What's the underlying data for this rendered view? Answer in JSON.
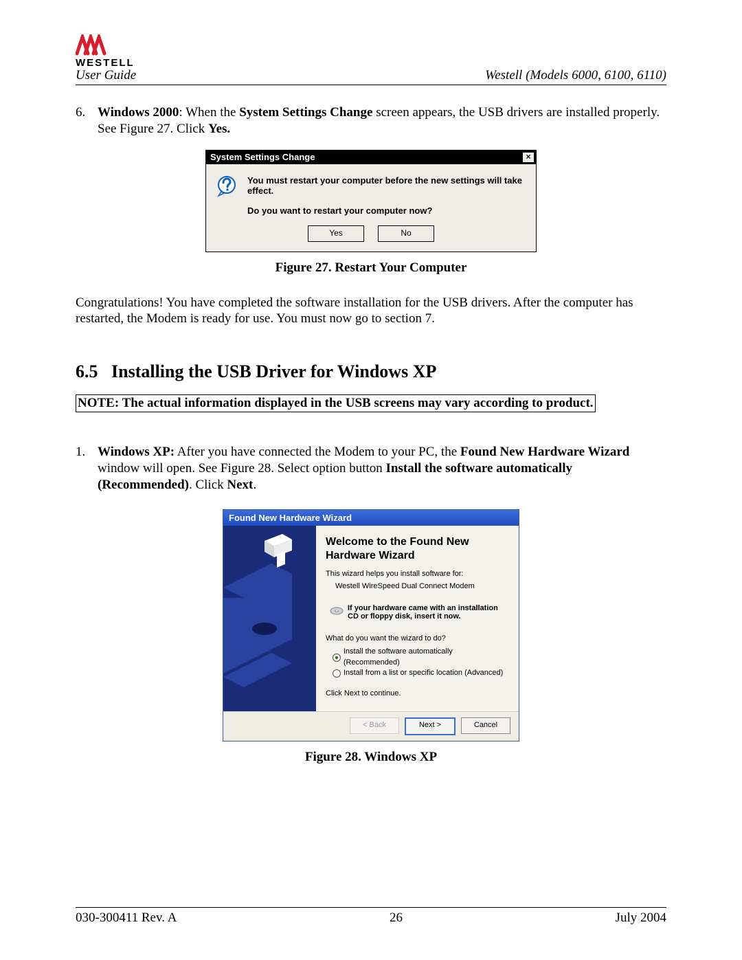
{
  "header": {
    "logo_text": "WESTELL",
    "user_guide": "User Guide",
    "models": "Westell (Models 6000, 6100, 6110)"
  },
  "step6": {
    "num": "6.",
    "bold1": "Windows 2000",
    "text1": ": When the ",
    "bold2": "System Settings Change",
    "text2": " screen appears, the USB drivers are installed properly. See Figure 27. Click ",
    "bold3": "Yes."
  },
  "dlg27": {
    "title": "System Settings Change",
    "close": "×",
    "msg1": "You must restart your computer before the new settings will take effect.",
    "msg2": "Do you want to restart your computer now?",
    "yes": "Yes",
    "no": "No",
    "caption": "Figure 27. Restart Your Computer"
  },
  "congrats": "Congratulations! You have completed the software installation for the USB drivers. After the computer has restarted, the Modem is ready for use. You must now go to section 7.",
  "section": {
    "num": "6.5",
    "title": "Installing the USB Driver for Windows XP"
  },
  "note": "NOTE: The actual information displayed in the USB screens may vary according to product.",
  "step1": {
    "num": "1.",
    "bold1": "Windows XP:",
    "text1": " After you have connected the Modem to your PC, the ",
    "bold2": "Found New Hardware Wizard",
    "text2": " window will open. See Figure 28. Select option button ",
    "bold3": "Install the software automatically (Recommended)",
    "text3": ". Click ",
    "bold4": "Next",
    "text4": "."
  },
  "dlg28": {
    "title": "Found New Hardware Wizard",
    "welcome": "Welcome to the Found New Hardware Wizard",
    "subt": "This wizard helps you install software for:",
    "device": "Westell WireSpeed Dual Connect Modem",
    "cdtext": "If your hardware came with an installation CD or floppy disk, insert it now.",
    "ask": "What do you want the wizard to do?",
    "opt1": "Install the software automatically (Recommended)",
    "opt2": "Install from a list or specific location (Advanced)",
    "cont": "Click Next to continue.",
    "back": "< Back",
    "next": "Next >",
    "cancel": "Cancel",
    "caption": "Figure 28. Windows XP"
  },
  "footer": {
    "left": "030-300411 Rev. A",
    "center": "26",
    "right": "July 2004"
  }
}
